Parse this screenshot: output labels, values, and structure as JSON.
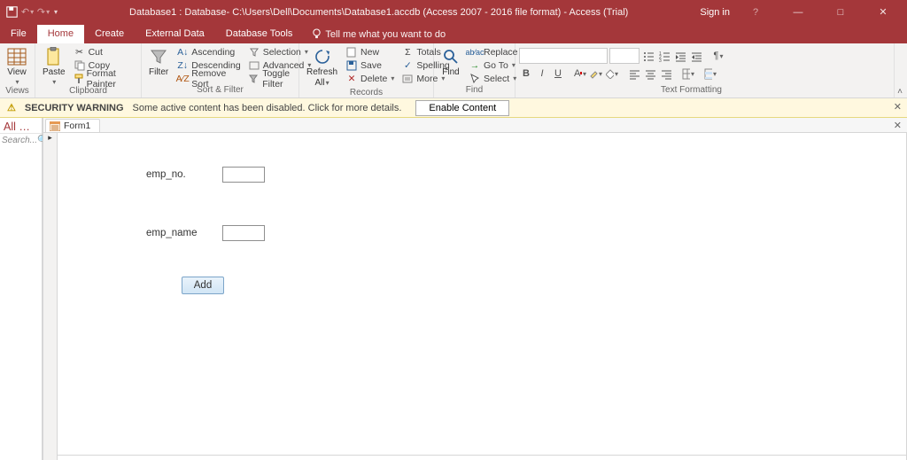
{
  "titlebar": {
    "title": "Database1 : Database- C:\\Users\\Dell\\Documents\\Database1.accdb (Access 2007 - 2016 file format) - Access (Trial)",
    "signin": "Sign in"
  },
  "tabs": {
    "file": "File",
    "home": "Home",
    "create": "Create",
    "external": "External Data",
    "dbtools": "Database Tools",
    "tellme": "Tell me what you want to do"
  },
  "ribbon": {
    "views": {
      "view": "View",
      "label": "Views"
    },
    "clipboard": {
      "paste": "Paste",
      "cut": "Cut",
      "copy": "Copy",
      "painter": "Format Painter",
      "label": "Clipboard"
    },
    "sortfilter": {
      "filter": "Filter",
      "asc": "Ascending",
      "desc": "Descending",
      "remove": "Remove Sort",
      "selection": "Selection",
      "advanced": "Advanced",
      "toggle": "Toggle Filter",
      "label": "Sort & Filter"
    },
    "records": {
      "refresh": "Refresh",
      "refresh2": "All",
      "new_": "New",
      "save": "Save",
      "delete_": "Delete",
      "totals": "Totals",
      "spelling": "Spelling",
      "more": "More",
      "label": "Records"
    },
    "find": {
      "find": "Find",
      "replace": "Replace",
      "goto": "Go To",
      "select": "Select",
      "label": "Find"
    },
    "textfmt": {
      "label": "Text Formatting"
    }
  },
  "security": {
    "title": "SECURITY WARNING",
    "msg": "Some active content has been disabled. Click for more details.",
    "btn": "Enable Content"
  },
  "nav": {
    "header": "All …",
    "search": "Search..."
  },
  "doc": {
    "tab": "Form1"
  },
  "form": {
    "emp_no_label": "emp_no.",
    "emp_name_label": "emp_name",
    "add_label": "Add"
  }
}
